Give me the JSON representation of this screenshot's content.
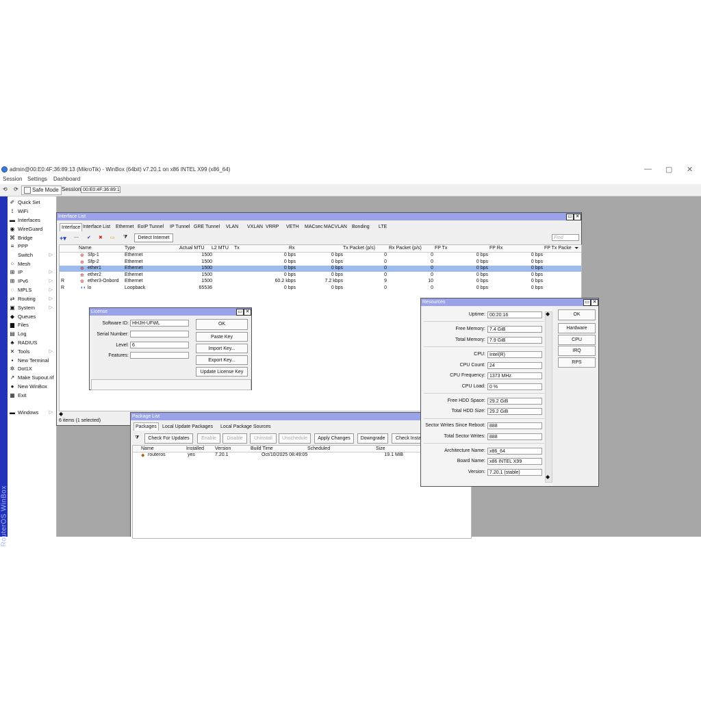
{
  "window": {
    "title": "admin@00:E0:4F:36:89:13 (MikroTik) - WinBox (64bit) v7.20.1 on x86 INTEL X99 (x86_64)",
    "controls": {
      "minimize": "—",
      "maximize": "▢",
      "close": "✕"
    }
  },
  "menu": [
    "Session",
    "Settings",
    "Dashboard"
  ],
  "toolbar": {
    "undo": "⟲",
    "redo": "⟳",
    "safe_mode": "Safe Mode",
    "session_label": "Session:",
    "session_value": "00:E0:4F:36:89:13"
  },
  "sidebar": {
    "brand": "RouterOS WinBox",
    "items": [
      {
        "label": "Quick Set",
        "icon": "wand-icon",
        "glyph": "✐"
      },
      {
        "label": "WiFi",
        "icon": "wifi-icon",
        "glyph": "⟟"
      },
      {
        "label": "Interfaces",
        "icon": "interfaces-icon",
        "glyph": "▬"
      },
      {
        "label": "WireGuard",
        "icon": "wireguard-icon",
        "glyph": "◉"
      },
      {
        "label": "Bridge",
        "icon": "bridge-icon",
        "glyph": "⌘"
      },
      {
        "label": "PPP",
        "icon": "ppp-icon",
        "glyph": "≡"
      },
      {
        "label": "Switch",
        "icon": "switch-icon",
        "glyph": ""
      },
      {
        "label": "Mesh",
        "icon": "mesh-icon",
        "glyph": "⁘"
      },
      {
        "label": "IP",
        "icon": "ip-icon",
        "glyph": "⊞"
      },
      {
        "label": "IPv6",
        "icon": "ipv6-icon",
        "glyph": "⊞"
      },
      {
        "label": "MPLS",
        "icon": "mpls-icon",
        "glyph": "◌"
      },
      {
        "label": "Routing",
        "icon": "routing-icon",
        "glyph": "⇄"
      },
      {
        "label": "System",
        "icon": "system-icon",
        "glyph": "▣"
      },
      {
        "label": "Queues",
        "icon": "queues-icon",
        "glyph": "◆"
      },
      {
        "label": "Files",
        "icon": "files-icon",
        "glyph": "▆"
      },
      {
        "label": "Log",
        "icon": "log-icon",
        "glyph": "▤"
      },
      {
        "label": "RADIUS",
        "icon": "radius-icon",
        "glyph": "♣"
      },
      {
        "label": "Tools",
        "icon": "tools-icon",
        "glyph": "✕"
      },
      {
        "label": "New Terminal",
        "icon": "terminal-icon",
        "glyph": "▪"
      },
      {
        "label": "Dot1X",
        "icon": "dot1x-icon",
        "glyph": "✲"
      },
      {
        "label": "Make Supout.rif",
        "icon": "supout-icon",
        "glyph": "↗"
      },
      {
        "label": "New WinBox",
        "icon": "winbox-icon",
        "glyph": "●"
      },
      {
        "label": "Exit",
        "icon": "exit-icon",
        "glyph": "▦"
      },
      {
        "label": "Windows",
        "icon": "windows-icon",
        "glyph": "▬"
      }
    ]
  },
  "interface_list": {
    "title": "Interface List",
    "tabs": [
      "Interface",
      "Interface List",
      "Ethernet",
      "EoIP Tunnel",
      "IP Tunnel",
      "GRE Tunnel",
      "VLAN",
      "VXLAN",
      "VRRP",
      "VETH",
      "MACsec",
      "MACVLAN",
      "Bonding",
      "LTE"
    ],
    "tools": {
      "add": "+▾",
      "remove": "—",
      "enable": "✔",
      "disable": "✖",
      "comment": "▭",
      "filter": "⧩",
      "detect": "Detect Internet",
      "find_placeholder": "Find"
    },
    "columns": [
      "Name",
      "Type",
      "Actual MTU",
      "L2 MTU",
      "Tx",
      "Rx",
      "Tx Packet (p/s)",
      "Rx Packet (p/s)",
      "FP Tx",
      "FP Rx",
      "FP Tx Packe"
    ],
    "rows": [
      {
        "flag": "",
        "name": "Sfp-1",
        "type": "Ethernet",
        "mtu": "1500",
        "tx": "0 bps",
        "rx": "0 bps",
        "txp": "0",
        "rxp": "0",
        "fptx": "0 bps",
        "fprx": "0 bps"
      },
      {
        "flag": "",
        "name": "Sfp-2",
        "type": "Ethernet",
        "mtu": "1500",
        "tx": "0 bps",
        "rx": "0 bps",
        "txp": "0",
        "rxp": "0",
        "fptx": "0 bps",
        "fprx": "0 bps"
      },
      {
        "flag": "",
        "name": "ether1",
        "type": "Ethernet",
        "mtu": "1500",
        "tx": "0 bps",
        "rx": "0 bps",
        "txp": "0",
        "rxp": "0",
        "fptx": "0 bps",
        "fprx": "0 bps"
      },
      {
        "flag": "",
        "name": "ether2",
        "type": "Ethernet",
        "mtu": "1500",
        "tx": "0 bps",
        "rx": "0 bps",
        "txp": "0",
        "rxp": "0",
        "fptx": "0 bps",
        "fprx": "0 bps"
      },
      {
        "flag": "R",
        "name": "ether3-Onbord",
        "type": "Ethernet",
        "mtu": "1500",
        "tx": "60.2 kbps",
        "rx": "7.2 kbps",
        "txp": "9",
        "rxp": "10",
        "fptx": "0 bps",
        "fprx": "0 bps"
      },
      {
        "flag": "R",
        "name": "lo",
        "type": "Loopback",
        "mtu": "65536",
        "tx": "0 bps",
        "rx": "0 bps",
        "txp": "0",
        "rxp": "0",
        "fptx": "0 bps",
        "fprx": "0 bps"
      }
    ],
    "selected_row": 2,
    "status": "6 items (1 selected)"
  },
  "license": {
    "title": "License",
    "software_id_label": "Software ID:",
    "software_id": "HHJH-UFWL",
    "serial_label": "Serial Number:",
    "serial": "",
    "level_label": "Level:",
    "level": "6",
    "features_label": "Features:",
    "features": "",
    "buttons": [
      "OK",
      "Paste Key",
      "Import Key...",
      "Export Key...",
      "Update License Key"
    ]
  },
  "packages": {
    "title": "Package List",
    "tabs": [
      "Packages",
      "Local Update Packages",
      "Local Package Sources"
    ],
    "buttons": [
      "Check For Updates",
      "Enable",
      "Disable",
      "Uninstall",
      "Unschedule",
      "Apply Changes",
      "Downgrade",
      "Check Insta"
    ],
    "columns": [
      "Name",
      "Installed",
      "Version",
      "Build Time",
      "Scheduled",
      "Size"
    ],
    "rows": [
      {
        "name": "routeros",
        "installed": "yes",
        "version": "7.20.1",
        "build": "Oct/10/2025 08:49:05",
        "scheduled": "",
        "size": "19.1 MiB"
      }
    ]
  },
  "resources": {
    "title": "Resources",
    "fields": [
      {
        "label": "Uptime:",
        "value": "00:20:16"
      },
      {
        "label": "Free Memory:",
        "value": "7.4 GiB"
      },
      {
        "label": "Total Memory:",
        "value": "7.9 GiB"
      },
      {
        "label": "CPU:",
        "value": "Intel(R)"
      },
      {
        "label": "CPU Count:",
        "value": "24"
      },
      {
        "label": "CPU Frequency:",
        "value": "1373 MHz"
      },
      {
        "label": "CPU Load:",
        "value": "0 %"
      },
      {
        "label": "Free HDD Space:",
        "value": "29.2 GiB"
      },
      {
        "label": "Total HDD Size:",
        "value": "29.2 GiB"
      },
      {
        "label": "Sector Writes Since Reboot:",
        "value": "888"
      },
      {
        "label": "Total Sector Writes:",
        "value": "888"
      },
      {
        "label": "Architecture Name:",
        "value": "x86_64"
      },
      {
        "label": "Board Name:",
        "value": "x86 INTEL X99"
      },
      {
        "label": "Version:",
        "value": "7.20.1 (stable)"
      }
    ],
    "buttons": [
      "OK",
      "Hardware",
      "CPU",
      "IRQ",
      "RPS"
    ]
  },
  "colors": {
    "accent": "#2233bb",
    "window_title": "#9aa3e9",
    "selected_row": "#9dbbec",
    "workspace": "#a7a7a7"
  }
}
